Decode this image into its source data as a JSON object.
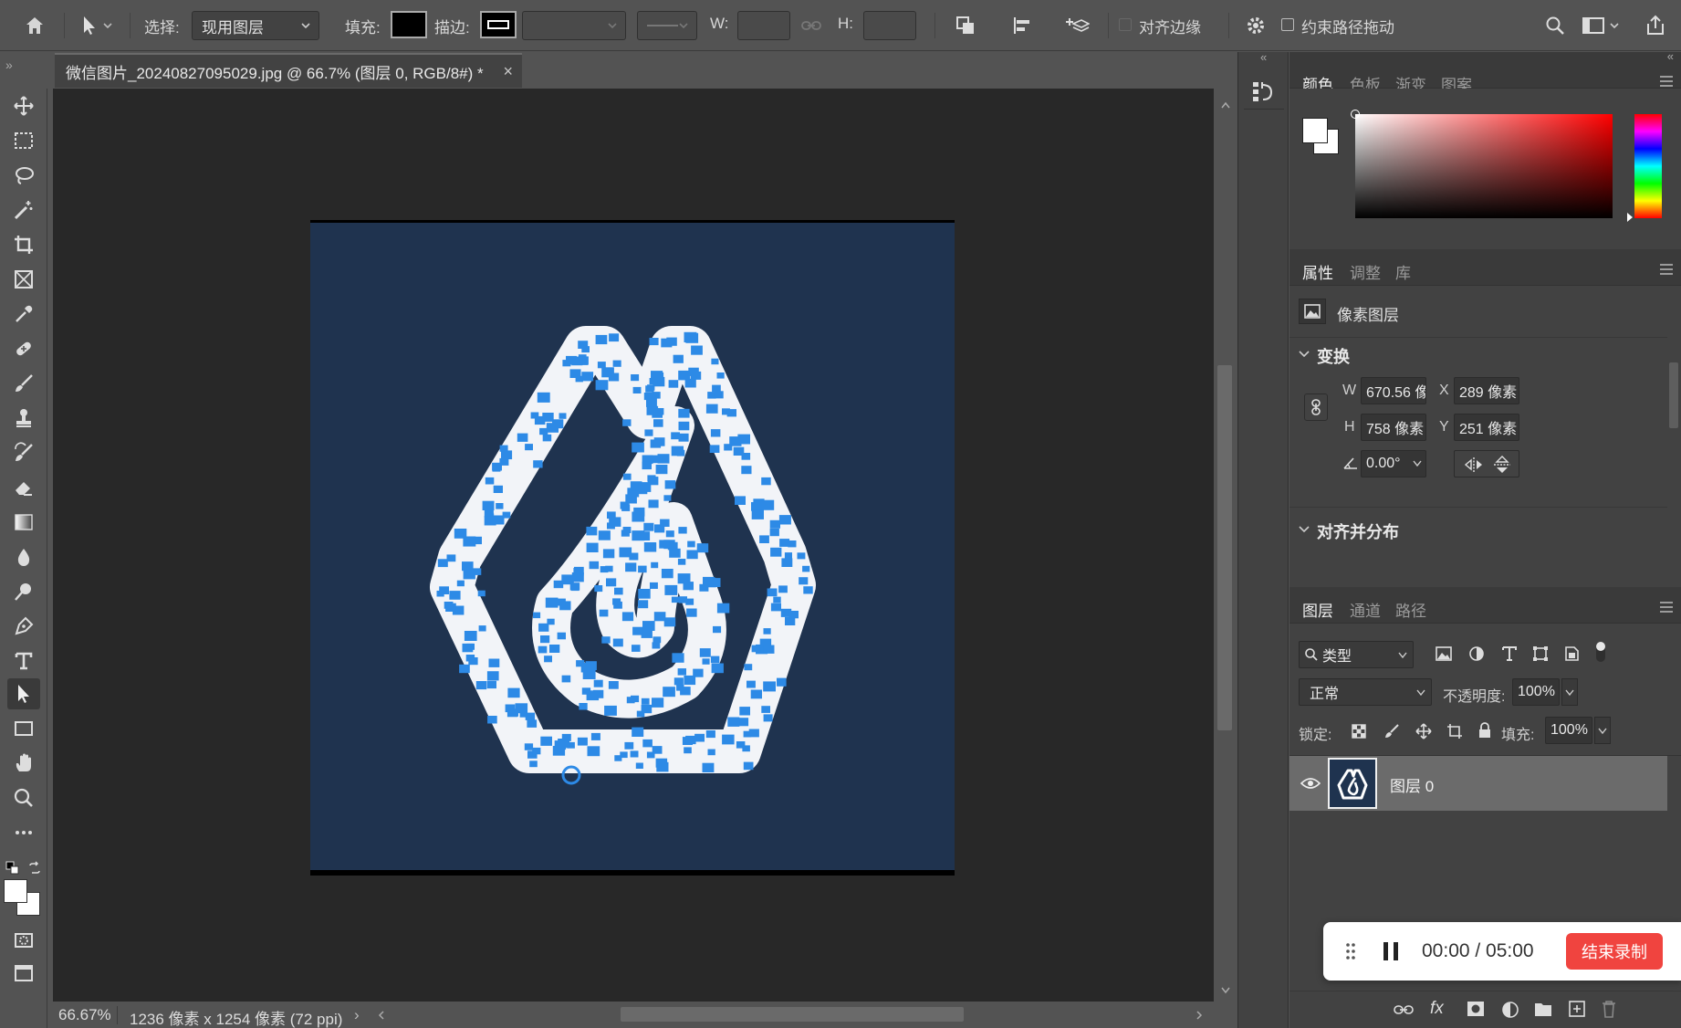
{
  "options_bar": {
    "select_label": "选择:",
    "select_value": "现用图层",
    "fill_label": "填充:",
    "stroke_label": "描边:",
    "w_label": "W:",
    "h_label": "H:",
    "align_edges_label": "对齐边缘",
    "constrain_path_label": "约束路径拖动"
  },
  "document_tab": {
    "title": "微信图片_20240827095029.jpg @ 66.7% (图层 0, RGB/8#) *",
    "close": "×"
  },
  "status_bar": {
    "zoom": "66.67%",
    "doc_info": "1236 像素 x 1254 像素 (72 ppi)",
    "arrow": "›"
  },
  "color_panel": {
    "tabs": [
      "颜色",
      "色板",
      "渐变",
      "图案"
    ]
  },
  "properties_panel": {
    "tabs": [
      "属性",
      "调整",
      "库"
    ],
    "layer_kind": "像素图层",
    "transform_title": "变换",
    "w_label": "W",
    "w_value": "670.56 像素",
    "x_label": "X",
    "x_value": "289 像素",
    "h_label": "H",
    "h_value": "758 像素",
    "y_label": "Y",
    "y_value": "251 像素",
    "angle_value": "0.00°",
    "align_title": "对齐并分布"
  },
  "layers_panel": {
    "tabs": [
      "图层",
      "通道",
      "路径"
    ],
    "filter_kind": "类型",
    "blend_mode": "正常",
    "opacity_label": "不透明度:",
    "opacity_value": "100%",
    "lock_label": "锁定:",
    "fill_label": "填充:",
    "fill_value": "100%",
    "layers": [
      {
        "name": "图层 0",
        "visible": true,
        "selected": true
      }
    ]
  },
  "recorder": {
    "time": "00:00 / 05:00",
    "stop_label": "结束录制"
  },
  "colors": {
    "ui_bg": "#535353",
    "panel_bg": "#424242",
    "canvas_bg": "#282828",
    "document_bg": "#1f334f",
    "anchor_blue": "#2d8ae6",
    "stop_red": "#f0443f"
  }
}
